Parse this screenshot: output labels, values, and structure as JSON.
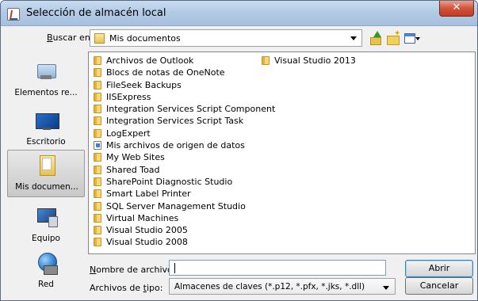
{
  "window": {
    "title": "Selección de almacén local",
    "close_label": "✕"
  },
  "toolbar": {
    "lookin_label_prefix": "",
    "lookin_label_accel": "B",
    "lookin_label_rest": "uscar en:",
    "lookin_value": "Mis documentos",
    "icons": [
      "up-one-level-icon",
      "new-folder-icon",
      "view-menu-icon"
    ]
  },
  "places": [
    {
      "label": "Elementos re...",
      "icon": "recent-items-icon"
    },
    {
      "label": "Escritorio",
      "icon": "desktop-icon"
    },
    {
      "label": "Mis documen...",
      "icon": "my-documents-icon",
      "selected": true
    },
    {
      "label": "Equipo",
      "icon": "computer-icon"
    },
    {
      "label": "Red",
      "icon": "network-icon"
    }
  ],
  "files": {
    "column1": [
      {
        "name": "Archivos de Outlook",
        "icon": "folder-icon"
      },
      {
        "name": "Blocs de notas de OneNote",
        "icon": "folder-icon"
      },
      {
        "name": "FileSeek Backups",
        "icon": "folder-icon"
      },
      {
        "name": "IISExpress",
        "icon": "folder-icon"
      },
      {
        "name": "Integration Services Script Component",
        "icon": "folder-icon"
      },
      {
        "name": "Integration Services Script Task",
        "icon": "folder-icon"
      },
      {
        "name": "LogExpert",
        "icon": "folder-icon"
      },
      {
        "name": "Mis archivos de origen de datos",
        "icon": "data-sources-folder-icon"
      },
      {
        "name": "My Web Sites",
        "icon": "folder-icon"
      },
      {
        "name": "Shared Toad",
        "icon": "folder-icon"
      },
      {
        "name": "SharePoint Diagnostic Studio",
        "icon": "folder-icon"
      },
      {
        "name": "Smart Label Printer",
        "icon": "folder-icon"
      },
      {
        "name": "SQL Server Management Studio",
        "icon": "folder-icon"
      },
      {
        "name": "Virtual Machines",
        "icon": "folder-icon"
      },
      {
        "name": "Visual Studio 2005",
        "icon": "folder-icon"
      },
      {
        "name": "Visual Studio 2008",
        "icon": "folder-icon"
      }
    ],
    "column2": [
      {
        "name": "Visual Studio 2013",
        "icon": "folder-icon"
      }
    ]
  },
  "filename": {
    "label_accel": "N",
    "label_rest": "ombre de archivo:",
    "value": ""
  },
  "filetype": {
    "label_prefix": "Archivos de ",
    "label_accel": "t",
    "label_rest": "ipo:",
    "value": "Almacenes de claves (*.p12, *.pfx, *.jks, *.dll)"
  },
  "buttons": {
    "open": "Abrir",
    "cancel": "Cancelar"
  }
}
